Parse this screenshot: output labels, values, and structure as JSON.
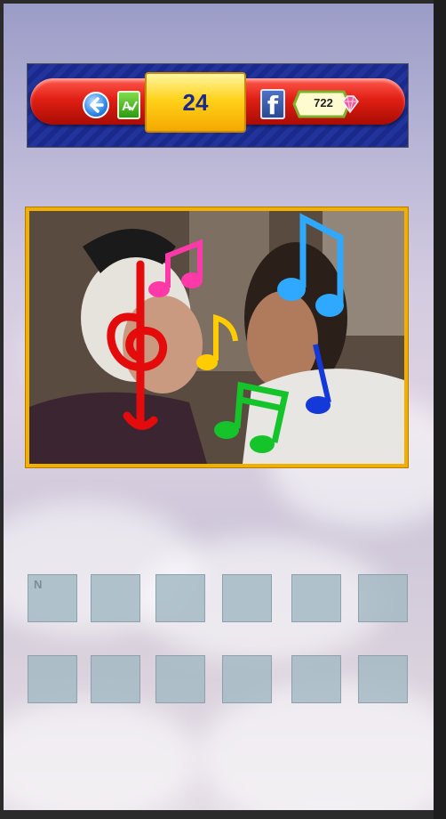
{
  "header": {
    "level": "24",
    "coins": "722",
    "back_icon": "back-arrow-icon",
    "hint_icon": "hint-icon",
    "share_icon": "facebook-icon",
    "coin_icon": "gem-icon"
  },
  "puzzle": {
    "image_description_icon": "photo",
    "answer_row1": [
      "N",
      "",
      "",
      "",
      "",
      ""
    ],
    "answer_row2": [
      "",
      "",
      "",
      "",
      "",
      ""
    ]
  },
  "colors": {
    "bar_red": "#e11f14",
    "level_gold": "#ffd21a",
    "frame_gold": "#f0b000",
    "slot": "#a4bac4"
  }
}
